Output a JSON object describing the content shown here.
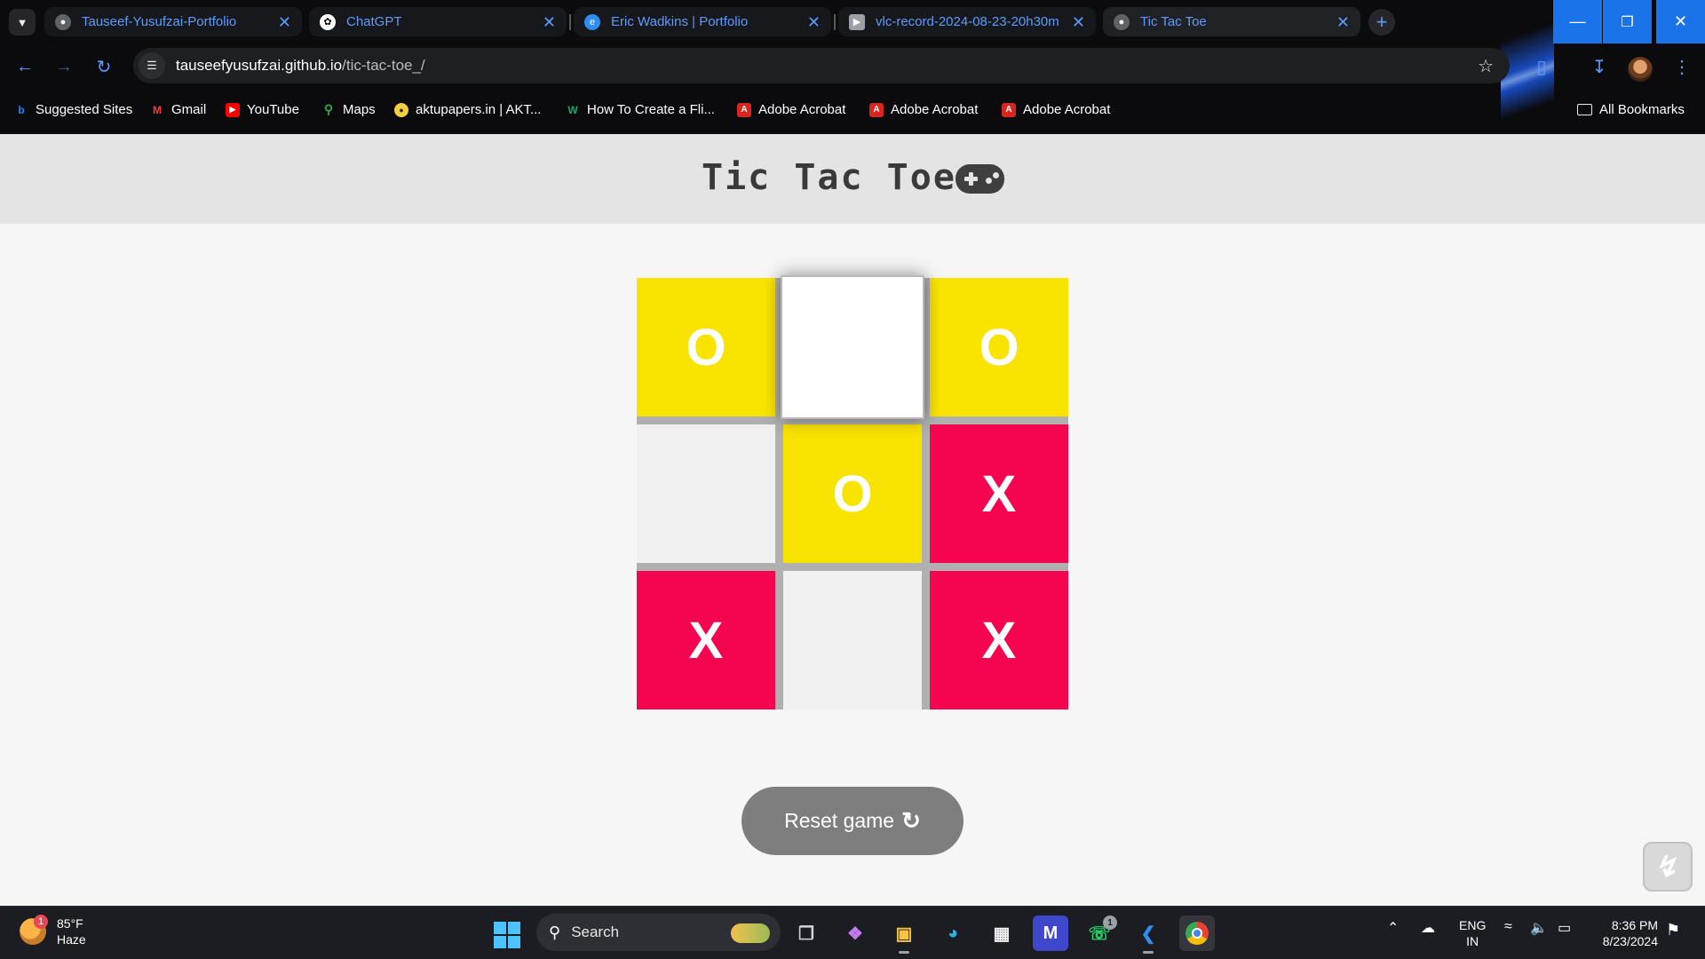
{
  "browser": {
    "tabs": [
      {
        "title": "Tauseef-Yusufzai-Portfolio",
        "icon": "globe-icon"
      },
      {
        "title": "ChatGPT",
        "icon": "chatgpt-icon"
      },
      {
        "title": "Eric Wadkins | Portfolio",
        "icon": "e-logo-icon"
      },
      {
        "title": "vlc-record-2024-08-23-20h30m",
        "icon": "video-file-icon"
      },
      {
        "title": "Tic Tac Toe",
        "icon": "globe-icon",
        "active": true
      }
    ],
    "url_domain": "tauseefyusufzai.github.io",
    "url_path": "/tic-tac-toe_/",
    "bookmarks": [
      {
        "label": "Suggested Sites",
        "icon": "bing-icon",
        "color": "#2f7cf6"
      },
      {
        "label": "Gmail",
        "icon": "gmail-icon",
        "color": "#ea4335"
      },
      {
        "label": "YouTube",
        "icon": "youtube-icon",
        "color": "#ff0000"
      },
      {
        "label": "Maps",
        "icon": "maps-pin-icon",
        "color": "#34a853"
      },
      {
        "label": "aktupapers.in | AKT...",
        "icon": "aktu-icon",
        "color": "#f4d03f"
      },
      {
        "label": "How To Create a Fli...",
        "icon": "w-logo-icon",
        "color": "#1ea56a"
      },
      {
        "label": "Adobe Acrobat",
        "icon": "acrobat-icon",
        "color": "#d7261e"
      },
      {
        "label": "Adobe Acrobat",
        "icon": "acrobat-icon",
        "color": "#d7261e"
      },
      {
        "label": "Adobe Acrobat",
        "icon": "acrobat-icon",
        "color": "#d7261e"
      }
    ],
    "all_bookmarks": "All Bookmarks"
  },
  "page": {
    "title": "Tic Tac Toe",
    "board": [
      {
        "value": "O",
        "state": "o"
      },
      {
        "value": "",
        "state": "hover"
      },
      {
        "value": "O",
        "state": "o"
      },
      {
        "value": "",
        "state": "empty"
      },
      {
        "value": "O",
        "state": "o"
      },
      {
        "value": "X",
        "state": "x"
      },
      {
        "value": "X",
        "state": "x"
      },
      {
        "value": "",
        "state": "empty"
      },
      {
        "value": "X",
        "state": "x"
      }
    ],
    "reset_label": "Reset game",
    "colors": {
      "o_cell": "#f9e300",
      "x_cell": "#f5044f",
      "empty_cell": "#f0f0f0",
      "board_grid": "#b0b0b0",
      "reset_button": "#7e7e7e"
    }
  },
  "taskbar": {
    "weather_temp": "85°F",
    "weather_desc": "Haze",
    "weather_badge": "1",
    "search_label": "Search",
    "lang_line1": "ENG",
    "lang_line2": "IN",
    "time": "8:36 PM",
    "date": "8/23/2024",
    "whatsapp_badge": "1"
  }
}
